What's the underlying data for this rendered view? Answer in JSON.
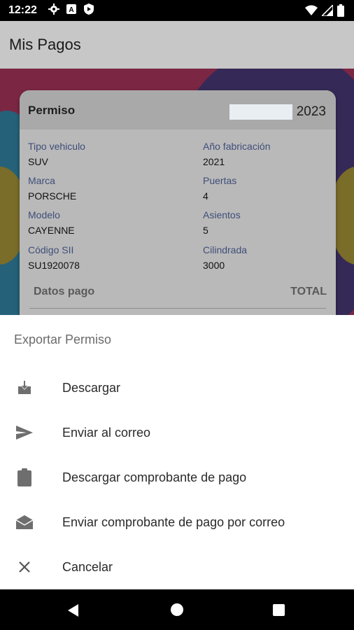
{
  "status_bar": {
    "time": "12:22",
    "icons_left": [
      "gear-icon",
      "a-icon",
      "shield-play-icon"
    ],
    "icons_right": [
      "wifi-icon",
      "signal-icon",
      "battery-icon"
    ]
  },
  "appbar": {
    "title": "Mis Pagos"
  },
  "card": {
    "title": "Permiso",
    "year": "2023",
    "fields": {
      "tipo_vehiculo": {
        "label": "Tipo vehiculo",
        "value": "SUV"
      },
      "anio_fabricacion": {
        "label": "Año fabricación",
        "value": "2021"
      },
      "marca": {
        "label": "Marca",
        "value": "PORSCHE"
      },
      "puertas": {
        "label": "Puertas",
        "value": "4"
      },
      "modelo": {
        "label": "Modelo",
        "value": "CAYENNE"
      },
      "asientos": {
        "label": "Asientos",
        "value": "5"
      },
      "codigo_sii": {
        "label": "Código SII",
        "value": "SU1920078"
      },
      "cilindrada": {
        "label": "Cilindrada",
        "value": "3000"
      }
    },
    "datos_pago": "Datos pago",
    "total": "TOTAL"
  },
  "sheet": {
    "title": "Exportar Permiso",
    "options": [
      {
        "icon": "download-tray-icon",
        "label": "Descargar"
      },
      {
        "icon": "send-icon",
        "label": "Enviar al correo"
      },
      {
        "icon": "clipboard-icon",
        "label": "Descargar comprobante de pago"
      },
      {
        "icon": "open-mail-icon",
        "label": "Enviar comprobante de pago por correo"
      },
      {
        "icon": "close-icon",
        "label": "Cancelar"
      }
    ]
  },
  "colors": {
    "sheet_bg": "#ffffff",
    "card_bg": "#b9b9b9",
    "field_label": "#3f4e7a",
    "icon_gray": "#6e6e6e"
  }
}
